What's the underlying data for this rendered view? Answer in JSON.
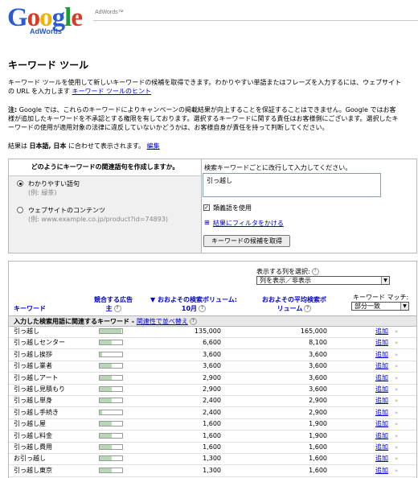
{
  "header": {
    "logo_letters": [
      "G",
      "o",
      "o",
      "g",
      "l",
      "e"
    ],
    "logo_colors": [
      "#2a5bd7",
      "#d83a2a",
      "#f0b400",
      "#2a5bd7",
      "#1a9a3a",
      "#d83a2a"
    ],
    "logo_sub": "AdWords",
    "product": "AdWords™"
  },
  "page": {
    "title": "キーワード ツール",
    "intro_text": "キーワード ツールを使用して新しいキーワードの候補を取得できます。わかりやすい単語またはフレーズを入力するには、ウェブサイトの URL を入力します",
    "intro_link": "キーワード ツールのヒント",
    "note_label": "注:",
    "note_text": " Google では、これらのキーワードによりキャンペーンの掲載結果が向上することを保証することはできません。Google ではお客様が追加したキーワードを不承認とする権限を有しております。選択するキーワードに関する責任はお客様側にございます。選択したキーワードの使用が適用対象の法律に違反していないかどうかは、お客様自身が責任を持って判断してください。",
    "lang_prefix": "結果は ",
    "lang_value": "日本語, 日本",
    "lang_suffix": " に合わせて表示されます。",
    "lang_edit": "編集"
  },
  "form": {
    "left_heading": "どのようにキーワードの関連語句を作成しますか。",
    "option1_label": "わかりやすい語句",
    "option1_example": "(例: 緑茶)",
    "option2_label": "ウェブサイトのコンテンツ",
    "option2_example": "(例: www.example.co.jp/product?id=74893)",
    "right_heading": "検索キーワードごとに改行して入力してください。",
    "textarea_value": "引っ越し",
    "synonyms_label": "類義語を使用",
    "filter_link": "結果にフィルタをかける",
    "submit_label": "キーワードの候補を取得"
  },
  "results": {
    "columns_label": "表示する列を選択:",
    "columns_select": "列を表示／非表示",
    "match_label": "キーワード マッチ:",
    "match_select": "部分一致",
    "col_keyword": "キーワード",
    "col_competition_1": "競合する広告",
    "col_competition_2": "主",
    "col_volume_1": "▼ おおよその検索ボリューム:",
    "col_volume_2": "10月",
    "col_avg_1": "おおよその平均検索ボ",
    "col_avg_2": "リューム",
    "section_title": "入力した検索用語に関連するキーワード - ",
    "section_link": "関連性で並べ替え",
    "add_label": "追加",
    "dbl_mark": "»",
    "rows": [
      {
        "keyword": "引っ越し",
        "competition": 0.95,
        "volume": "135,000",
        "avg": "165,000"
      },
      {
        "keyword": "引っ越しセンター",
        "competition": 0.55,
        "volume": "6,600",
        "avg": "8,100"
      },
      {
        "keyword": "引っ越し挨拶",
        "competition": 0.1,
        "volume": "3,600",
        "avg": "3,600"
      },
      {
        "keyword": "引っ越し業者",
        "competition": 0.55,
        "volume": "3,600",
        "avg": "3,600"
      },
      {
        "keyword": "引っ越しアート",
        "competition": 0.55,
        "volume": "2,900",
        "avg": "3,600"
      },
      {
        "keyword": "引っ越し見積もり",
        "competition": 0.55,
        "volume": "2,900",
        "avg": "3,600"
      },
      {
        "keyword": "引っ越し単身",
        "competition": 0.55,
        "volume": "2,400",
        "avg": "2,900"
      },
      {
        "keyword": "引っ越し手続き",
        "competition": 0.1,
        "volume": "2,400",
        "avg": "2,900"
      },
      {
        "keyword": "引っ越し屋",
        "competition": 0.55,
        "volume": "1,600",
        "avg": "1,900"
      },
      {
        "keyword": "引っ越し料金",
        "competition": 0.55,
        "volume": "1,600",
        "avg": "1,900"
      },
      {
        "keyword": "引っ越し費用",
        "competition": 0.55,
        "volume": "1,600",
        "avg": "1,600"
      },
      {
        "keyword": "お引っ越し",
        "competition": 0.55,
        "volume": "1,300",
        "avg": "1,600"
      },
      {
        "keyword": "引っ越し東京",
        "competition": 0.55,
        "volume": "1,300",
        "avg": "1,600"
      }
    ]
  }
}
